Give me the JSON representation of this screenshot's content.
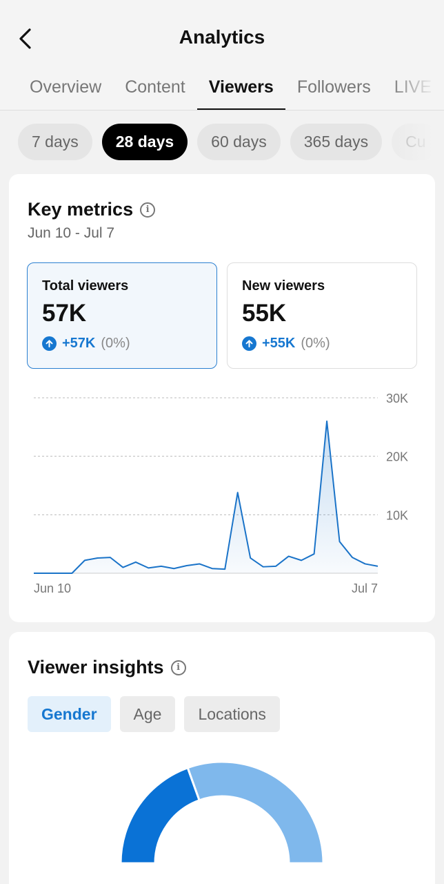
{
  "header": {
    "title": "Analytics",
    "back_icon": "chevron-left-icon"
  },
  "tabs": [
    {
      "label": "Overview",
      "active": false
    },
    {
      "label": "Content",
      "active": false
    },
    {
      "label": "Viewers",
      "active": true
    },
    {
      "label": "Followers",
      "active": false
    },
    {
      "label": "LIVE",
      "active": false
    }
  ],
  "ranges": [
    {
      "label": "7 days",
      "active": false
    },
    {
      "label": "28 days",
      "active": true
    },
    {
      "label": "60 days",
      "active": false
    },
    {
      "label": "365 days",
      "active": false
    },
    {
      "label": "Cu",
      "active": false
    }
  ],
  "key_metrics": {
    "title": "Key metrics",
    "date_range": "Jun 10 - Jul 7",
    "metrics": [
      {
        "label": "Total viewers",
        "value": "57K",
        "change": "+57K",
        "pct": "(0%)",
        "selected": true
      },
      {
        "label": "New viewers",
        "value": "55K",
        "change": "+55K",
        "pct": "(0%)",
        "selected": false
      }
    ]
  },
  "chart_data": {
    "type": "area",
    "title": "",
    "xlabel": "",
    "ylabel": "",
    "x_labels": [
      "Jun 10",
      "Jul 7"
    ],
    "yticks": [
      "10K",
      "20K",
      "30K"
    ],
    "ylim": [
      0,
      30000
    ],
    "grid": true,
    "series": [
      {
        "values": [
          0,
          0,
          0,
          0,
          2200,
          2600,
          2700,
          1000,
          1900,
          900,
          1200,
          800,
          1300,
          1600,
          800,
          700,
          13800,
          2600,
          1100,
          1200,
          2900,
          2200,
          3300,
          26000,
          5400,
          2700,
          1600,
          1200
        ],
        "color": "#1a73c8"
      }
    ]
  },
  "viewer_insights": {
    "title": "Viewer insights",
    "tabs": [
      {
        "label": "Gender",
        "active": true
      },
      {
        "label": "Age",
        "active": false
      },
      {
        "label": "Locations",
        "active": false
      }
    ],
    "donut": {
      "segments": [
        {
          "value": 0.39,
          "color": "#0a72d6"
        },
        {
          "value": 0.61,
          "color": "#7fb8ec"
        }
      ]
    }
  },
  "colors": {
    "accent": "#1677d0",
    "line": "#1a73c8"
  }
}
